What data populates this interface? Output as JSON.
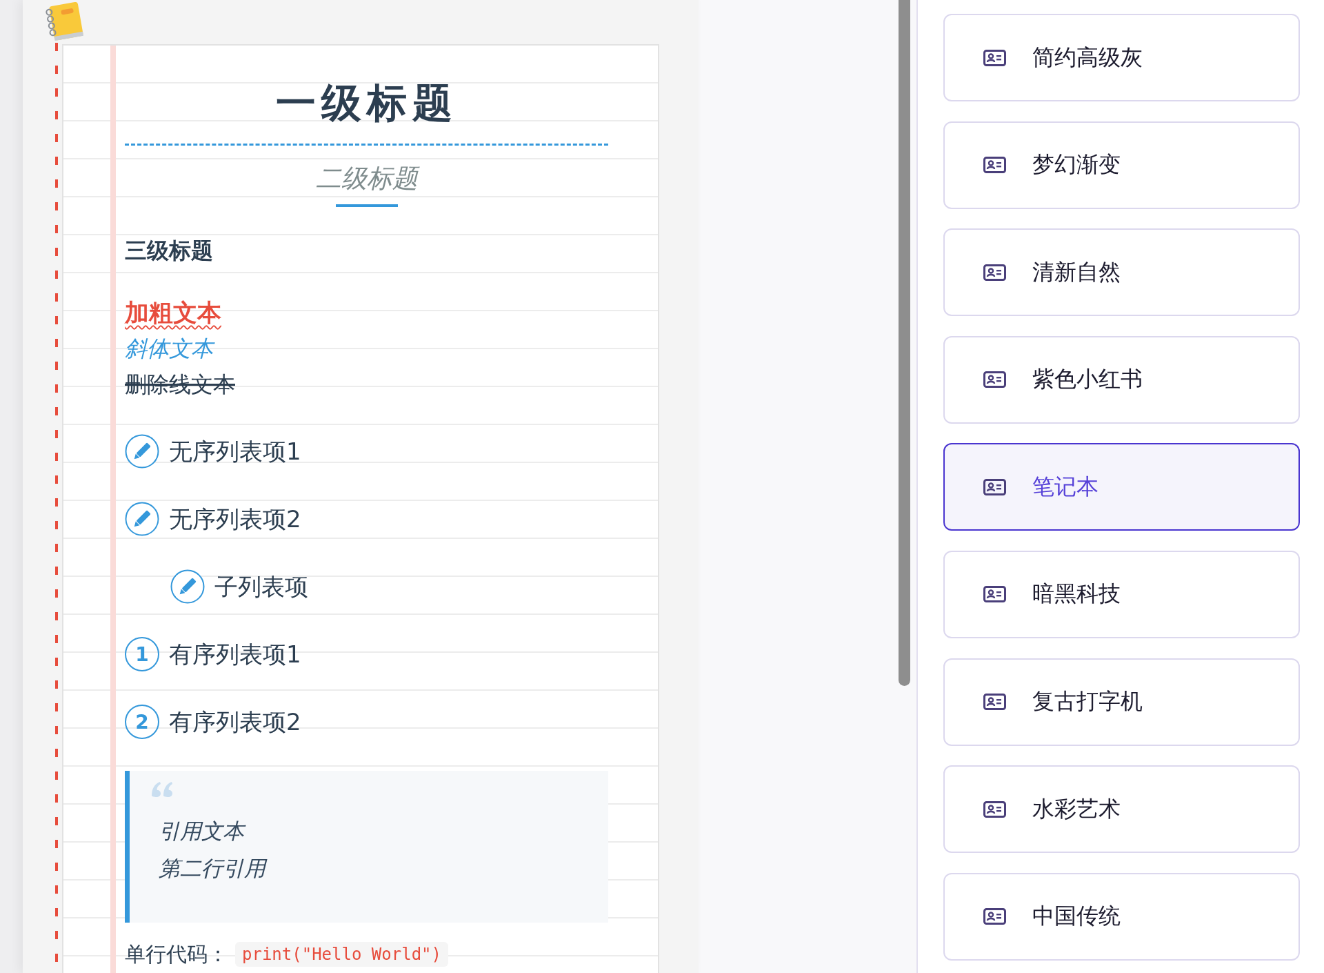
{
  "document": {
    "heading_1": "一级标题",
    "heading_2": "二级标题",
    "heading_3": "三级标题",
    "inline_texts": [
      {
        "kind": "bold",
        "text": "加粗文本"
      },
      {
        "kind": "italic",
        "text": "斜体文本"
      },
      {
        "kind": "strikethrough",
        "text": "删除线文本"
      }
    ],
    "list_items": [
      {
        "kind": "bullet",
        "text": "无序列表项1"
      },
      {
        "kind": "bullet",
        "text": "无序列表项2",
        "children": [
          {
            "kind": "bullet",
            "text": "子列表项"
          }
        ]
      },
      {
        "kind": "number",
        "marker": "1",
        "text": "有序列表项1"
      },
      {
        "kind": "number",
        "marker": "2",
        "text": "有序列表项2"
      }
    ],
    "blockquote": {
      "lines": [
        "引用文本",
        "第二行引用"
      ]
    },
    "code_line": {
      "label": "单行代码：",
      "code": "print(\"Hello World\")"
    }
  },
  "themes": [
    {
      "label": "简约高级灰",
      "selected": false
    },
    {
      "label": "梦幻渐变",
      "selected": false
    },
    {
      "label": "清新自然",
      "selected": false
    },
    {
      "label": "紫色小红书",
      "selected": false
    },
    {
      "label": "笔记本",
      "selected": true
    },
    {
      "label": "暗黑科技",
      "selected": false
    },
    {
      "label": "复古打字机",
      "selected": false
    },
    {
      "label": "水彩艺术",
      "selected": false
    },
    {
      "label": "中国传统",
      "selected": false
    }
  ]
}
